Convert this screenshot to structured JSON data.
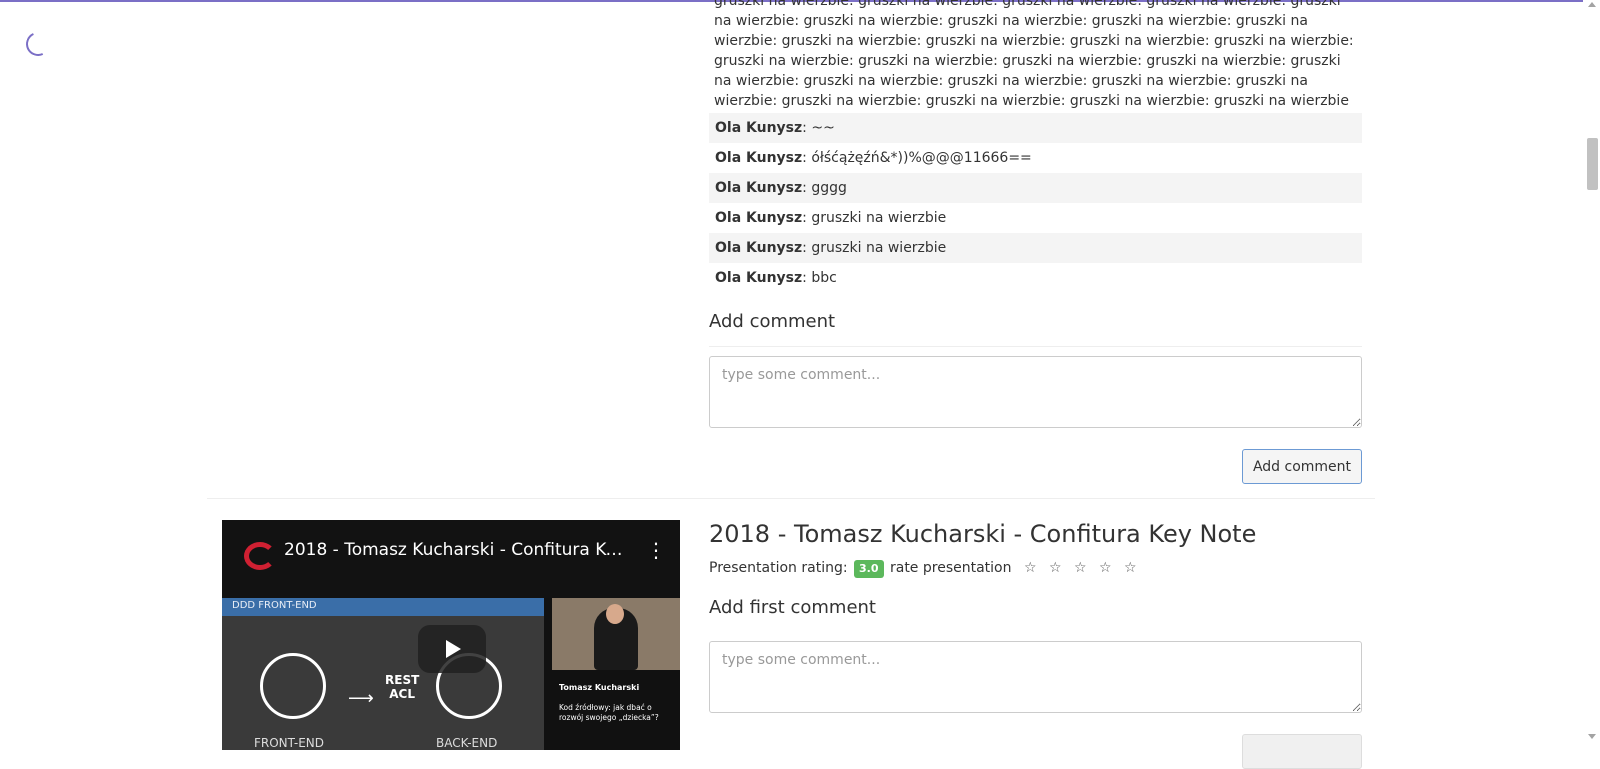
{
  "previous_comment_text": "gruszki na wierzbie: gruszki na wierzbie: gruszki na wierzbie: gruszki na wierzbie: gruszki na wierzbie: gruszki na wierzbie: gruszki na wierzbie: gruszki na wierzbie: gruszki na wierzbie: gruszki na wierzbie: gruszki na wierzbie: gruszki na wierzbie: gruszki na wierzbie: gruszki na wierzbie: gruszki na wierzbie: gruszki na wierzbie: gruszki na wierzbie: gruszki na wierzbie: gruszki na wierzbie: gruszki na wierzbie: gruszki na wierzbie: gruszki na wierzbie: gruszki na wierzbie: gruszki na wierzbie: gruszki na wierzbie: gruszki na wierzbie",
  "comments": [
    {
      "author": "Ola Kunysz",
      "text": "~~"
    },
    {
      "author": "Ola Kunysz",
      "text": "ółśćążęźń&*))%@@@11666=="
    },
    {
      "author": "Ola Kunysz",
      "text": "gggg"
    },
    {
      "author": "Ola Kunysz",
      "text": "gruszki na wierzbie"
    },
    {
      "author": "Ola Kunysz",
      "text": "gruszki na wierzbie"
    },
    {
      "author": "Ola Kunysz",
      "text": "bbc"
    }
  ],
  "add_comment_heading": "Add comment",
  "comment_placeholder": "type some comment...",
  "add_comment_button": "Add comment",
  "next_talk": {
    "title": "2018 - Tomasz Kucharski - Confitura Key Note",
    "rating_label": "Presentation rating:",
    "rating_value": "3.0",
    "rate_label": "rate presentation",
    "stars": [
      "☆",
      "☆",
      "☆",
      "☆",
      "☆"
    ],
    "add_first_comment_heading": "Add first comment",
    "comment_placeholder": "type some comment..."
  },
  "video": {
    "title": "2018 - Tomasz Kucharski - Confitura Key ...",
    "band_label": "DDD FRONT-END",
    "center_label_line1": "REST",
    "center_label_line2": "ACL",
    "left_label": "FRONT-END",
    "right_label": "BACK-END",
    "speaker_name": "Tomasz Kucharski",
    "speaker_caption": "Kod źródłowy: jak dbać o rozwój swojego „dziecka”?",
    "menu_icon": "⋮"
  },
  "colors": {
    "accent": "#7b6fc6",
    "rating_badge": "#5cb85c",
    "button_border": "#6c9ad4"
  }
}
